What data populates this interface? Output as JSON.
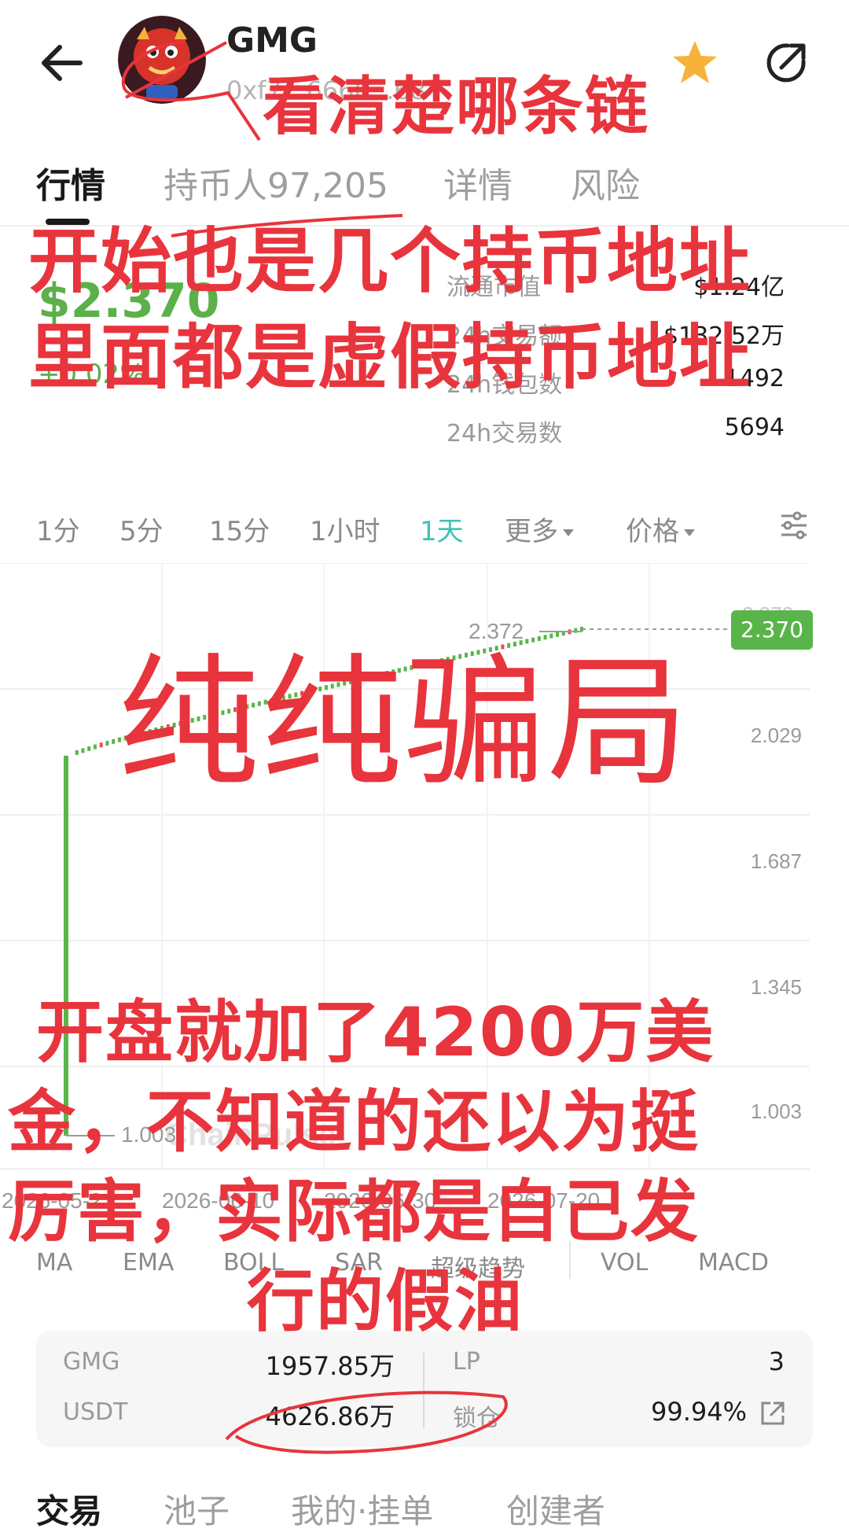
{
  "header": {
    "token_name": "GMG",
    "contract_address": "0xf7...6666...68不",
    "icons": [
      "back-arrow-icon",
      "avatar-dragon-icon",
      "favorite-star-icon",
      "share-icon"
    ],
    "star_color": "#f6b33b"
  },
  "tabs": [
    {
      "label": "行情",
      "active": true
    },
    {
      "label": "持币人97,205",
      "active": false
    },
    {
      "label": "详情",
      "active": false
    },
    {
      "label": "风险",
      "active": false
    }
  ],
  "price": {
    "current": "$2.370",
    "change": "+0.02%",
    "up_color": "#5bb04a"
  },
  "stats": [
    {
      "label": "流通市值",
      "value": "$1.24亿"
    },
    {
      "label": "24h交易额",
      "value": "$132.52万"
    },
    {
      "label": "24h钱包数",
      "value": "1492"
    },
    {
      "label": "24h交易数",
      "value": "5694"
    }
  ],
  "intervals": {
    "items": [
      "1分",
      "5分",
      "15分",
      "1小时",
      "1天",
      "更多",
      "价格"
    ],
    "active": "1天",
    "active_color": "#3cc3b6"
  },
  "chart": {
    "watermark": "ChainPulse",
    "last_price_label": "2.370",
    "high_label": "2.372",
    "low_label": "1.003",
    "cut_top_label": "2.372"
  },
  "chart_data": {
    "type": "candlestick",
    "y_ticks": [
      "2.029",
      "1.687",
      "1.345",
      "1.003"
    ],
    "x_ticks": [
      "2026-05-2",
      "2026-06-10",
      "2026-06-30",
      "2026-07-20"
    ],
    "ylim": [
      1.003,
      2.372
    ],
    "first_candle": {
      "open": 1.003,
      "close": 2.03
    },
    "trend_start": 2.03,
    "trend_end": 2.37,
    "last_price": 2.37,
    "up_color": "#59b54a",
    "grid": true
  },
  "indicators": [
    "MA",
    "EMA",
    "BOLL",
    "SAR",
    "超级趋势",
    "VOL",
    "MACD"
  ],
  "pool": {
    "rows": [
      {
        "token": "GMG",
        "amount": "1957.85万",
        "right_label": "LP",
        "right_value": "3"
      },
      {
        "token": "USDT",
        "amount": "4626.86万",
        "right_label": "锁仓",
        "right_value": "99.94%"
      }
    ]
  },
  "bottom_tabs": [
    {
      "label": "交易",
      "active": true
    },
    {
      "label": "池子",
      "active": false
    },
    {
      "label": "我的·挂单",
      "active": false
    },
    {
      "label": "创建者",
      "active": false
    }
  ],
  "annotations": {
    "color": "#e8343c",
    "note1": "看清楚哪条链",
    "note2": "开始也是几个持币地址",
    "note3": "里面都是虚假持币地址",
    "note4": "纯纯骗局",
    "note5_line1": "开盘就加了4200万美",
    "note5_line2": "金，不知道的还以为挺",
    "note5_line3": "厉害，实际都是自己发",
    "note5_line4": "行的假油"
  }
}
